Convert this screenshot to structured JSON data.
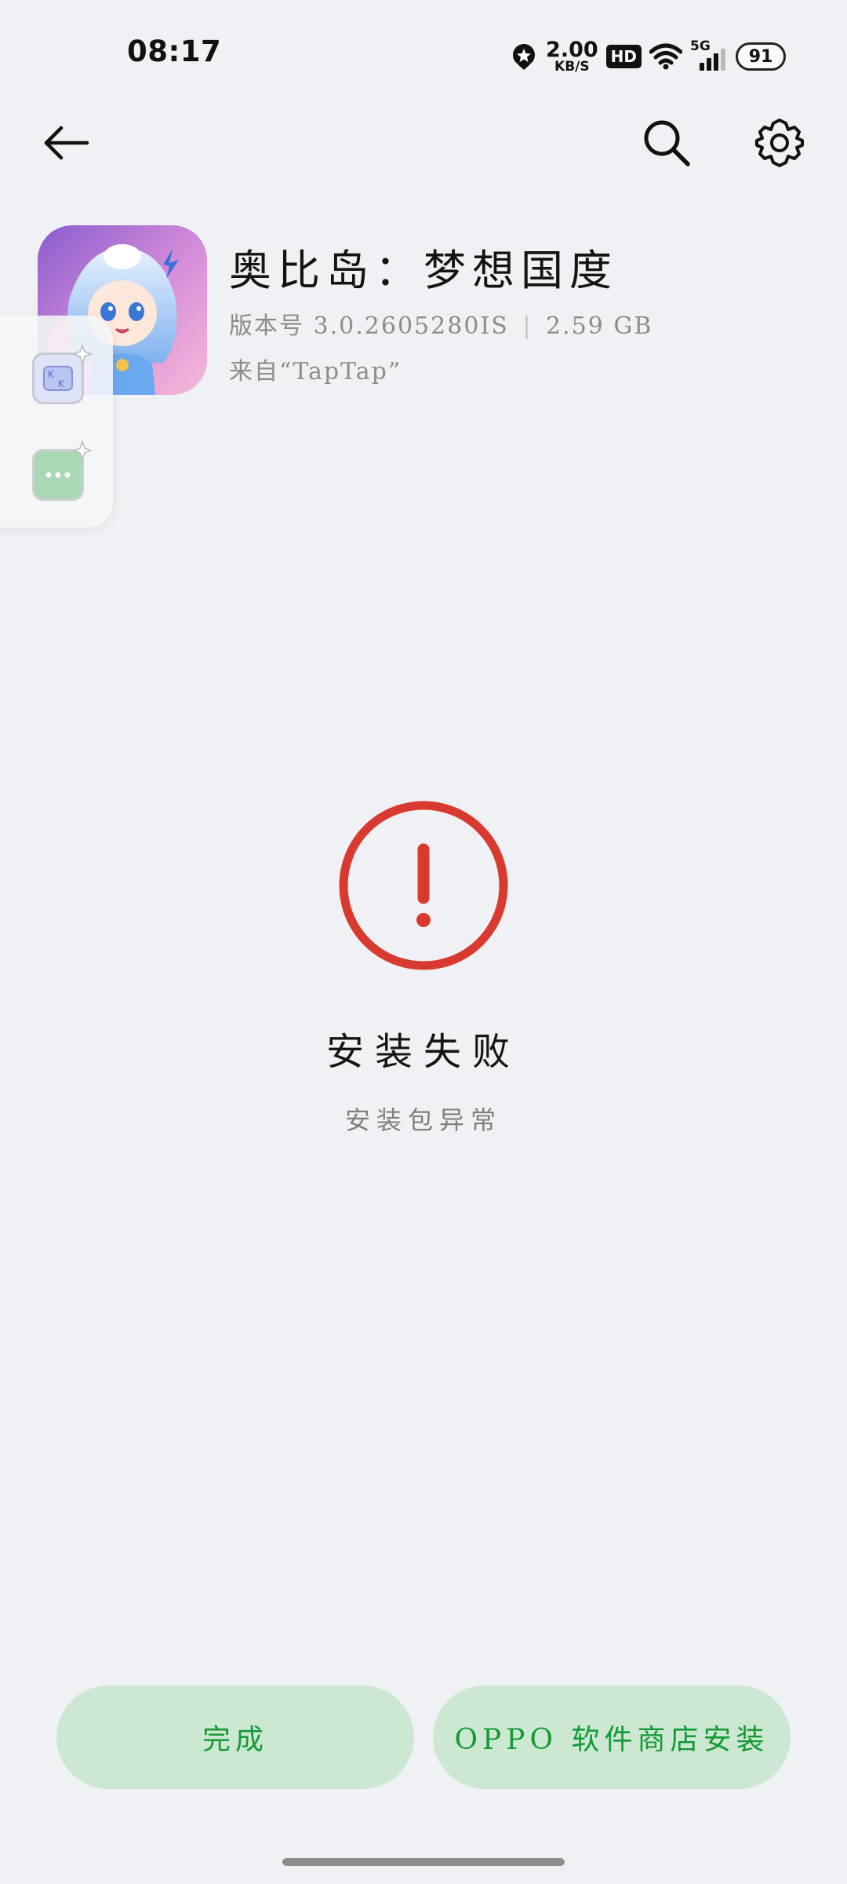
{
  "status_bar": {
    "time": "08:17",
    "net_speed_value": "2.00",
    "net_speed_unit": "KB/S",
    "hd": "HD",
    "network": "5G",
    "battery": "91"
  },
  "nav": {
    "back_icon": "arrow-left-icon",
    "search_icon": "search-icon",
    "settings_icon": "gear-icon"
  },
  "app": {
    "title": "奥比岛：梦想国度",
    "version_label": "版本号",
    "version": "3.0.2605280IS",
    "size": "2.59 GB",
    "source": "来自“TapTap”"
  },
  "side_panel": {
    "kk_label": "K K"
  },
  "status": {
    "title": "安装失败",
    "subtitle": "安装包异常",
    "icon": "exclamation-circle-icon",
    "color": "#d93a2f"
  },
  "actions": {
    "done_label": "完成",
    "store_install_label": "OPPO 软件商店安装"
  },
  "colors": {
    "background": "#f0f1f4",
    "button_bg": "#cce8d2",
    "button_text": "#159a35"
  }
}
